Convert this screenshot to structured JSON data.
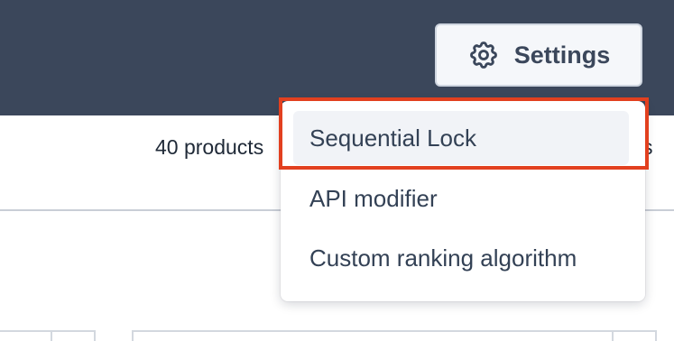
{
  "colors": {
    "header_background": "#3b475b",
    "highlight_border": "#e2401f",
    "active_item_background": "#f1f3f7",
    "menu_text": "#334155"
  },
  "header": {
    "settings_button": {
      "label": "Settings",
      "icon": "gear-icon"
    }
  },
  "content": {
    "product_count": "40 products",
    "trailing_text": "s"
  },
  "settings_menu": {
    "items": [
      {
        "label": "Sequential Lock",
        "hovered": true
      },
      {
        "label": "API modifier",
        "hovered": false
      },
      {
        "label": "Custom ranking algorithm",
        "hovered": false
      }
    ],
    "highlighted_item": "Sequential Lock"
  }
}
